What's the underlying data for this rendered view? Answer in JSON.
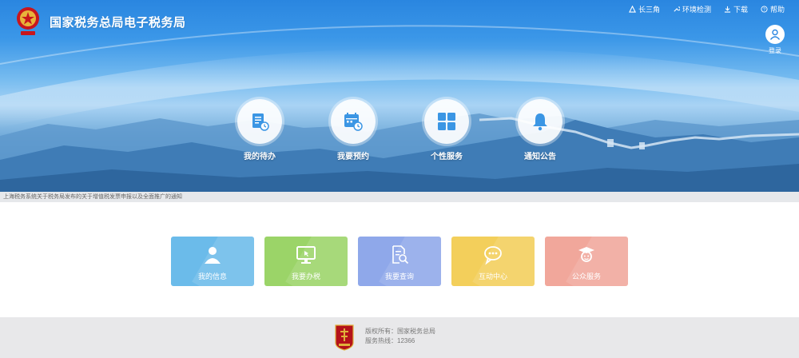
{
  "header": {
    "title": "国家税务总局电子税务局",
    "links": [
      {
        "label": "长三角",
        "icon": "triangle-icon"
      },
      {
        "label": "环境检测",
        "icon": "wrench-icon"
      },
      {
        "label": "下载",
        "icon": "download-icon"
      },
      {
        "label": "帮助",
        "icon": "help-icon"
      }
    ],
    "login_label": "登录"
  },
  "hero_menu": [
    {
      "label": "我的待办",
      "icon": "todo-clock-icon"
    },
    {
      "label": "我要预约",
      "icon": "calendar-clock-icon"
    },
    {
      "label": "个性服务",
      "icon": "grid-icon"
    },
    {
      "label": "通知公告",
      "icon": "bell-icon"
    }
  ],
  "notice": "上海税务系统关于税务局发布的关于增值税发票申报以及全面推广的通知",
  "tiles": [
    {
      "label": "我的信息",
      "color": "#6bbbea",
      "icon": "user-icon"
    },
    {
      "label": "我要办税",
      "color": "#9bd468",
      "icon": "monitor-icon"
    },
    {
      "label": "我要查询",
      "color": "#8fa8ea",
      "icon": "search-doc-icon"
    },
    {
      "label": "互动中心",
      "color": "#f3cf5b",
      "icon": "chat-icon"
    },
    {
      "label": "公众服务",
      "color": "#f1a79b",
      "icon": "graduate-icon"
    }
  ],
  "footer": {
    "line1": "版权所有：国家税务总局",
    "line2": "服务热线：12366"
  },
  "colors": {
    "primary": "#2a86e0",
    "emblem_red": "#c8161d"
  }
}
